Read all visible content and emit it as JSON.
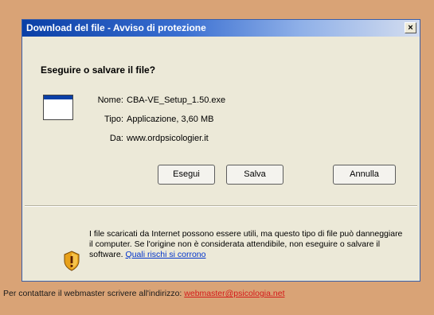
{
  "dialog": {
    "title": "Download del file - Avviso di protezione",
    "close_symbol": "×",
    "question": "Eseguire o salvare il file?",
    "fields": [
      {
        "label": "Nome:",
        "value": "CBA-VE_Setup_1.50.exe"
      },
      {
        "label": "Tipo:",
        "value": "Applicazione, 3,60 MB"
      },
      {
        "label": "Da:",
        "value": "www.ordpsicologier.it"
      }
    ],
    "buttons": {
      "run": "Esegui",
      "save": "Salva",
      "cancel": "Annulla"
    },
    "warning": {
      "text": "I file scaricati da Internet possono essere utili, ma questo tipo di file può danneggiare il computer. Se l'origine non è considerata attendibile, non eseguire o salvare il software.",
      "link": "Quali rischi si corrono"
    },
    "icons": {
      "file": "application-file-icon",
      "warning": "security-shield-icon",
      "close": "close-icon"
    }
  },
  "footer": {
    "text": "Per contattare il webmaster scrivere all'indirizzo:",
    "link": "webmaster@psicologia.net"
  },
  "colors": {
    "page_background": "#d9a376",
    "titlebar": "#0a3fa6",
    "dialog_background": "#ece9d8",
    "link": "#0033cc",
    "footer_link": "#d41a1a"
  }
}
